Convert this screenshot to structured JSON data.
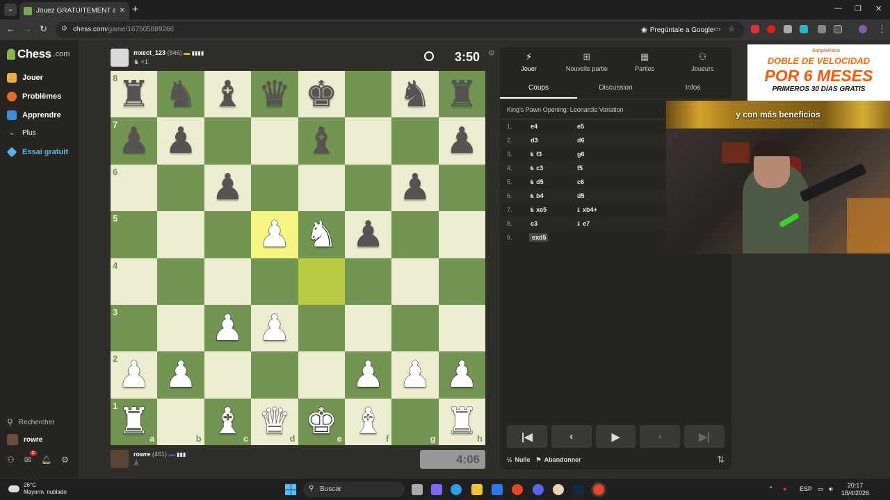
{
  "browser": {
    "tab_title": "Jouez GRATUITEMENT aux échecs",
    "url_host": "chess.com",
    "url_path": "/game/167505889266",
    "ask_google": "Pregúntale a Google"
  },
  "sidebar": {
    "logo": "Chess",
    "logo_suffix": ".com",
    "items": [
      {
        "label": "Jouer"
      },
      {
        "label": "Problèmes"
      },
      {
        "label": "Apprendre"
      },
      {
        "label": "Plus"
      },
      {
        "label": "Essai gratuit"
      }
    ],
    "search": "Rechercher",
    "username": "rowre",
    "notification_count": "5"
  },
  "top_player": {
    "name": "mxect_123",
    "rating": "(846)",
    "material": "+1",
    "clock": "3:50"
  },
  "bottom_player": {
    "name": "rowre",
    "rating": "(461)",
    "clock": "4:06"
  },
  "board": {
    "ranks": [
      "8",
      "7",
      "6",
      "5",
      "4",
      "3",
      "2",
      "1"
    ],
    "files": [
      "a",
      "b",
      "c",
      "d",
      "e",
      "f",
      "g",
      "h"
    ],
    "highlight_light": [
      "d5"
    ],
    "highlight_dark": [
      "e4"
    ],
    "position": {
      "a8": "r",
      "b8": "n",
      "c8": "b",
      "d8": "q",
      "e8": "k",
      "g8": "n",
      "h8": "r",
      "a7": "p",
      "b7": "p",
      "e7": "b",
      "h7": "p",
      "c6": "p",
      "g6": "p",
      "d5": "P",
      "e5": "N",
      "f5": "p",
      "c3": "P",
      "d3": "P",
      "a2": "P",
      "b2": "P",
      "f2": "P",
      "g2": "P",
      "h2": "P",
      "a1": "R",
      "c1": "B",
      "d1": "Q",
      "e1": "K",
      "f1": "B",
      "h1": "R"
    }
  },
  "panel": {
    "top_tabs": [
      {
        "label": "Jouer",
        "icon": "bolt-icon"
      },
      {
        "label": "Nouvelle partie",
        "icon": "plus-icon"
      },
      {
        "label": "Parties",
        "icon": "board-icon"
      },
      {
        "label": "Joueurs",
        "icon": "people-icon"
      }
    ],
    "sub_tabs": [
      "Coups",
      "Discussion",
      "Infos"
    ],
    "opening": "King's Pawn Opening: Leonardis Variation",
    "moves": [
      {
        "num": "1.",
        "w": "e4",
        "wp": "",
        "b": "e5",
        "bp": ""
      },
      {
        "num": "2.",
        "w": "d3",
        "wp": "",
        "b": "d6",
        "bp": ""
      },
      {
        "num": "3.",
        "w": "f3",
        "wp": "♞",
        "b": "g6",
        "bp": ""
      },
      {
        "num": "4.",
        "w": "c3",
        "wp": "♞",
        "b": "f5",
        "bp": ""
      },
      {
        "num": "5.",
        "w": "d5",
        "wp": "♞",
        "b": "c6",
        "bp": ""
      },
      {
        "num": "6.",
        "w": "b4",
        "wp": "♞",
        "b": "d5",
        "bp": ""
      },
      {
        "num": "7.",
        "w": "xe5",
        "wp": "♞",
        "b": "xb4+",
        "bp": "♝"
      },
      {
        "num": "8.",
        "w": "c3",
        "wp": "",
        "b": "e7",
        "bp": "♝"
      },
      {
        "num": "9.",
        "w": "exd5",
        "wp": "",
        "b": "",
        "bp": ""
      }
    ],
    "draw_label": "Nulle",
    "draw_prefix": "½",
    "resign_label": "Abandonner"
  },
  "ad": {
    "brand": "SimpleFibra",
    "line1": "DOBLE DE VELOCIDAD",
    "line2": "POR 6 MESES",
    "line3": "PRIMEROS 30 DÍAS GRATIS"
  },
  "stream_banner": "y con más beneficios",
  "taskbar": {
    "temperature": "26°C",
    "weather": "Mayorm. nublado",
    "search": "Buscar",
    "lang": "ESP",
    "time": "20:17",
    "date": "18/4/2026"
  },
  "colors": {
    "light_square": "#ebecd0",
    "dark_square": "#739552",
    "highlight": "#f5f682",
    "accent_green": "#81b64c"
  }
}
